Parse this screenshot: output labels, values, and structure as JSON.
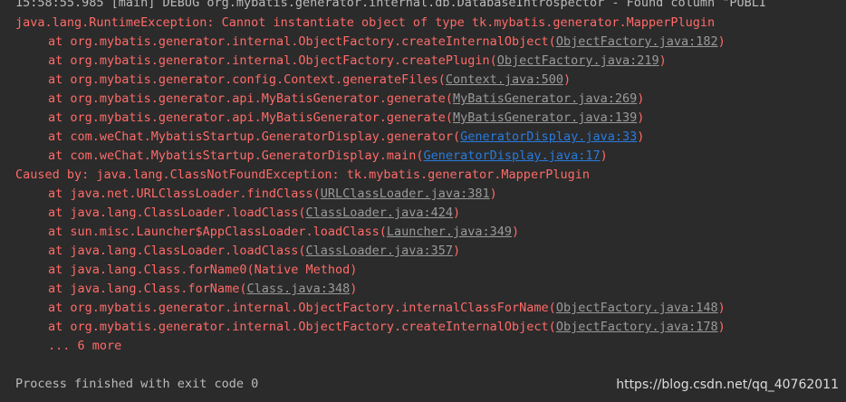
{
  "console": {
    "top_line": "15:58:55.985 [main] DEBUG org.mybatis.generator.internal.db.DatabaseIntrospector - Found column \"PUBLI",
    "exception": "java.lang.RuntimeException: Cannot instantiate object of type tk.mybatis.generator.MapperPlugin",
    "frames": [
      {
        "prefix": "at org.mybatis.generator.internal.ObjectFactory.createInternalObject(",
        "link": "ObjectFactory.java:182",
        "suffix": ")"
      },
      {
        "prefix": "at org.mybatis.generator.internal.ObjectFactory.createPlugin(",
        "link": "ObjectFactory.java:219",
        "suffix": ")"
      },
      {
        "prefix": "at org.mybatis.generator.config.Context.generateFiles(",
        "link": "Context.java:500",
        "suffix": ")"
      },
      {
        "prefix": "at org.mybatis.generator.api.MyBatisGenerator.generate(",
        "link": "MyBatisGenerator.java:269",
        "suffix": ")"
      },
      {
        "prefix": "at org.mybatis.generator.api.MyBatisGenerator.generate(",
        "link": "MyBatisGenerator.java:139",
        "suffix": ")"
      },
      {
        "prefix": "at com.weChat.MybatisStartup.GeneratorDisplay.generator(",
        "link": "GeneratorDisplay.java:33",
        "suffix": ")"
      },
      {
        "prefix": "at com.weChat.MybatisStartup.GeneratorDisplay.main(",
        "link": "GeneratorDisplay.java:17",
        "suffix": ")"
      }
    ],
    "caused_by": "Caused by: java.lang.ClassNotFoundException: tk.mybatis.generator.MapperPlugin",
    "cause_frames": [
      {
        "prefix": "at java.net.URLClassLoader.findClass(",
        "link": "URLClassLoader.java:381",
        "suffix": ")"
      },
      {
        "prefix": "at java.lang.ClassLoader.loadClass(",
        "link": "ClassLoader.java:424",
        "suffix": ")"
      },
      {
        "prefix": "at sun.misc.Launcher$AppClassLoader.loadClass(",
        "link": "Launcher.java:349",
        "suffix": ")"
      },
      {
        "prefix": "at java.lang.ClassLoader.loadClass(",
        "link": "ClassLoader.java:357",
        "suffix": ")"
      },
      {
        "prefix": "at java.lang.Class.forName0(Native Method)",
        "link": "",
        "suffix": ""
      },
      {
        "prefix": "at java.lang.Class.forName(",
        "link": "Class.java:348",
        "suffix": ")"
      },
      {
        "prefix": "at org.mybatis.generator.internal.ObjectFactory.internalClassForName(",
        "link": "ObjectFactory.java:148",
        "suffix": ")"
      },
      {
        "prefix": "at org.mybatis.generator.internal.ObjectFactory.createInternalObject(",
        "link": "ObjectFactory.java:178",
        "suffix": ")"
      }
    ],
    "more": "... 6 more",
    "process_finished": "Process finished with exit code 0"
  },
  "watermark": "https://blog.csdn.net/qq_40762011",
  "colors": {
    "background": "#2b2b2b",
    "error_text": "#ff6b68",
    "normal_text": "#bbbbbb",
    "link_gray": "#9a9a9a",
    "link_blue": "#287bde"
  }
}
